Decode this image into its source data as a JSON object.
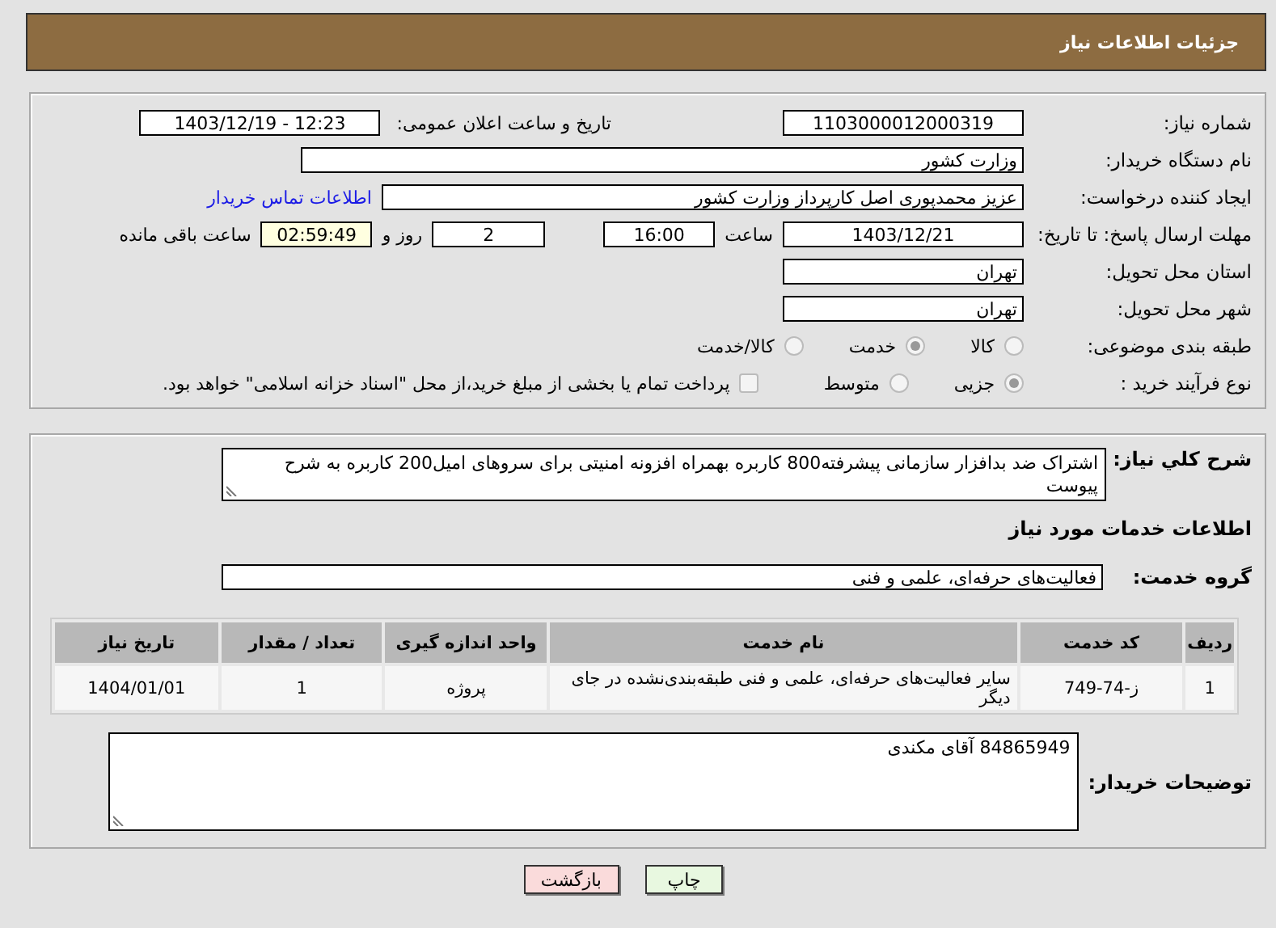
{
  "header": {
    "title": "جزئیات اطلاعات نیاز"
  },
  "need_number": {
    "label": "شماره نیاز:",
    "value": "1103000012000319"
  },
  "announce": {
    "label": "تاریخ و ساعت اعلان عمومی:",
    "value": "1403/12/19 - 12:23"
  },
  "buyer_org": {
    "label": "نام دستگاه خریدار:",
    "value": "وزارت کشور"
  },
  "requester": {
    "label": "ایجاد کننده درخواست:",
    "value": "عزیز محمدپوری اصل کارپرداز وزارت کشور",
    "link": "اطلاعات تماس خریدار"
  },
  "deadline": {
    "label": "مهلت ارسال پاسخ: تا تاریخ:",
    "date": "1403/12/21",
    "time_label": "ساعت",
    "time": "16:00",
    "days": "2",
    "days_label": "روز و",
    "remaining": "02:59:49",
    "remaining_label": "ساعت باقی مانده"
  },
  "province": {
    "label": "استان محل تحویل:",
    "value": "تهران"
  },
  "city": {
    "label": "شهر محل تحویل:",
    "value": "تهران"
  },
  "category": {
    "label": "طبقه بندی موضوعی:",
    "options": [
      {
        "label": "کالا",
        "selected": false
      },
      {
        "label": "خدمت",
        "selected": true
      },
      {
        "label": "کالا/خدمت",
        "selected": false
      }
    ]
  },
  "purchase_process": {
    "label": "نوع فرآیند خرید :",
    "options": [
      {
        "label": "جزیی",
        "selected": true
      },
      {
        "label": "متوسط",
        "selected": false
      }
    ],
    "treasury": {
      "label": "پرداخت تمام یا بخشی از مبلغ خرید،از محل \"اسناد خزانه اسلامی\" خواهد بود.",
      "checked": false
    }
  },
  "description": {
    "label": "شرح کلي نياز:",
    "value": "اشتراک ضد بدافزار سازمانی پیشرفته800 کاربره بهمراه افزونه امنیتی برای سروهای امیل200 کاربره به شرح پیوست"
  },
  "services_heading": "اطلاعات خدمات مورد نياز",
  "service_group": {
    "label": "گروه خدمت:",
    "value": "فعالیت‌های حرفه‌ای، علمی و فنی"
  },
  "table": {
    "columns": [
      "ردیف",
      "کد خدمت",
      "نام خدمت",
      "واحد اندازه گیری",
      "تعداد / مقدار",
      "تاریخ نیاز"
    ],
    "rows": [
      [
        "1",
        "ز-74-749",
        "سایر فعالیت‌های حرفه‌ای، علمی و فنی طبقه‌بندی‌نشده در جای دیگر",
        "پروژه",
        "1",
        "1404/01/01"
      ]
    ]
  },
  "buyer_notes": {
    "label": "توضیحات خریدار:",
    "value": "84865949 آقای مکندی"
  },
  "buttons": [
    {
      "label": "چاپ",
      "kind": "print"
    },
    {
      "label": "بازگشت",
      "kind": "back"
    }
  ]
}
